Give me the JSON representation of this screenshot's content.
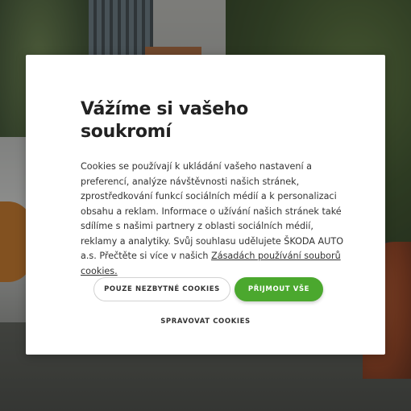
{
  "consent_dialog": {
    "title": "Vážíme si vašeho soukromí",
    "body_text": "Cookies se používají k ukládání vašeho nastavení a preferencí, analýze návštěvnosti našich stránek, zprostředkování funkcí sociálních médií a k personalizaci obsahu a reklam. Informace o užívání našich stránek také sdílíme s našimi partnery z oblasti sociálních médií, reklamy a analytiky. Svůj souhlasu udělujete ŠKODA AUTO a.s. Přečtěte si více v našich",
    "policy_link": "Zásadách používání souborů cookies.",
    "necessary_button": "POUZE NEZBYTNÉ COOKIES",
    "accept_button": "PŘIJMOUT VŠE",
    "manage_button": "SPRAVOVAT COOKIES",
    "accent_color": "#4ba82e"
  }
}
